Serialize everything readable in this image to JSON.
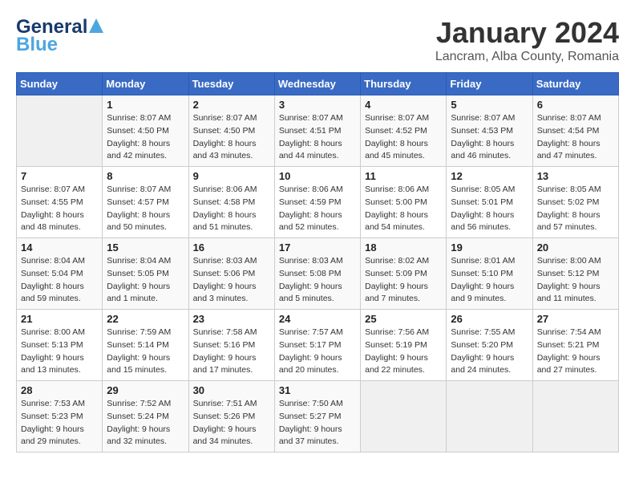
{
  "header": {
    "logo_line1": "General",
    "logo_line2": "Blue",
    "title": "January 2024",
    "subtitle": "Lancram, Alba County, Romania"
  },
  "calendar": {
    "weekdays": [
      "Sunday",
      "Monday",
      "Tuesday",
      "Wednesday",
      "Thursday",
      "Friday",
      "Saturday"
    ],
    "weeks": [
      [
        {
          "day": "",
          "empty": true
        },
        {
          "day": "1",
          "sunrise": "8:07 AM",
          "sunset": "4:50 PM",
          "daylight": "8 hours and 42 minutes."
        },
        {
          "day": "2",
          "sunrise": "8:07 AM",
          "sunset": "4:50 PM",
          "daylight": "8 hours and 43 minutes."
        },
        {
          "day": "3",
          "sunrise": "8:07 AM",
          "sunset": "4:51 PM",
          "daylight": "8 hours and 44 minutes."
        },
        {
          "day": "4",
          "sunrise": "8:07 AM",
          "sunset": "4:52 PM",
          "daylight": "8 hours and 45 minutes."
        },
        {
          "day": "5",
          "sunrise": "8:07 AM",
          "sunset": "4:53 PM",
          "daylight": "8 hours and 46 minutes."
        },
        {
          "day": "6",
          "sunrise": "8:07 AM",
          "sunset": "4:54 PM",
          "daylight": "8 hours and 47 minutes."
        }
      ],
      [
        {
          "day": "7",
          "sunrise": "8:07 AM",
          "sunset": "4:55 PM",
          "daylight": "8 hours and 48 minutes."
        },
        {
          "day": "8",
          "sunrise": "8:07 AM",
          "sunset": "4:57 PM",
          "daylight": "8 hours and 50 minutes."
        },
        {
          "day": "9",
          "sunrise": "8:06 AM",
          "sunset": "4:58 PM",
          "daylight": "8 hours and 51 minutes."
        },
        {
          "day": "10",
          "sunrise": "8:06 AM",
          "sunset": "4:59 PM",
          "daylight": "8 hours and 52 minutes."
        },
        {
          "day": "11",
          "sunrise": "8:06 AM",
          "sunset": "5:00 PM",
          "daylight": "8 hours and 54 minutes."
        },
        {
          "day": "12",
          "sunrise": "8:05 AM",
          "sunset": "5:01 PM",
          "daylight": "8 hours and 56 minutes."
        },
        {
          "day": "13",
          "sunrise": "8:05 AM",
          "sunset": "5:02 PM",
          "daylight": "8 hours and 57 minutes."
        }
      ],
      [
        {
          "day": "14",
          "sunrise": "8:04 AM",
          "sunset": "5:04 PM",
          "daylight": "8 hours and 59 minutes."
        },
        {
          "day": "15",
          "sunrise": "8:04 AM",
          "sunset": "5:05 PM",
          "daylight": "9 hours and 1 minute."
        },
        {
          "day": "16",
          "sunrise": "8:03 AM",
          "sunset": "5:06 PM",
          "daylight": "9 hours and 3 minutes."
        },
        {
          "day": "17",
          "sunrise": "8:03 AM",
          "sunset": "5:08 PM",
          "daylight": "9 hours and 5 minutes."
        },
        {
          "day": "18",
          "sunrise": "8:02 AM",
          "sunset": "5:09 PM",
          "daylight": "9 hours and 7 minutes."
        },
        {
          "day": "19",
          "sunrise": "8:01 AM",
          "sunset": "5:10 PM",
          "daylight": "9 hours and 9 minutes."
        },
        {
          "day": "20",
          "sunrise": "8:00 AM",
          "sunset": "5:12 PM",
          "daylight": "9 hours and 11 minutes."
        }
      ],
      [
        {
          "day": "21",
          "sunrise": "8:00 AM",
          "sunset": "5:13 PM",
          "daylight": "9 hours and 13 minutes."
        },
        {
          "day": "22",
          "sunrise": "7:59 AM",
          "sunset": "5:14 PM",
          "daylight": "9 hours and 15 minutes."
        },
        {
          "day": "23",
          "sunrise": "7:58 AM",
          "sunset": "5:16 PM",
          "daylight": "9 hours and 17 minutes."
        },
        {
          "day": "24",
          "sunrise": "7:57 AM",
          "sunset": "5:17 PM",
          "daylight": "9 hours and 20 minutes."
        },
        {
          "day": "25",
          "sunrise": "7:56 AM",
          "sunset": "5:19 PM",
          "daylight": "9 hours and 22 minutes."
        },
        {
          "day": "26",
          "sunrise": "7:55 AM",
          "sunset": "5:20 PM",
          "daylight": "9 hours and 24 minutes."
        },
        {
          "day": "27",
          "sunrise": "7:54 AM",
          "sunset": "5:21 PM",
          "daylight": "9 hours and 27 minutes."
        }
      ],
      [
        {
          "day": "28",
          "sunrise": "7:53 AM",
          "sunset": "5:23 PM",
          "daylight": "9 hours and 29 minutes."
        },
        {
          "day": "29",
          "sunrise": "7:52 AM",
          "sunset": "5:24 PM",
          "daylight": "9 hours and 32 minutes."
        },
        {
          "day": "30",
          "sunrise": "7:51 AM",
          "sunset": "5:26 PM",
          "daylight": "9 hours and 34 minutes."
        },
        {
          "day": "31",
          "sunrise": "7:50 AM",
          "sunset": "5:27 PM",
          "daylight": "9 hours and 37 minutes."
        },
        {
          "day": "",
          "empty": true
        },
        {
          "day": "",
          "empty": true
        },
        {
          "day": "",
          "empty": true
        }
      ]
    ]
  }
}
